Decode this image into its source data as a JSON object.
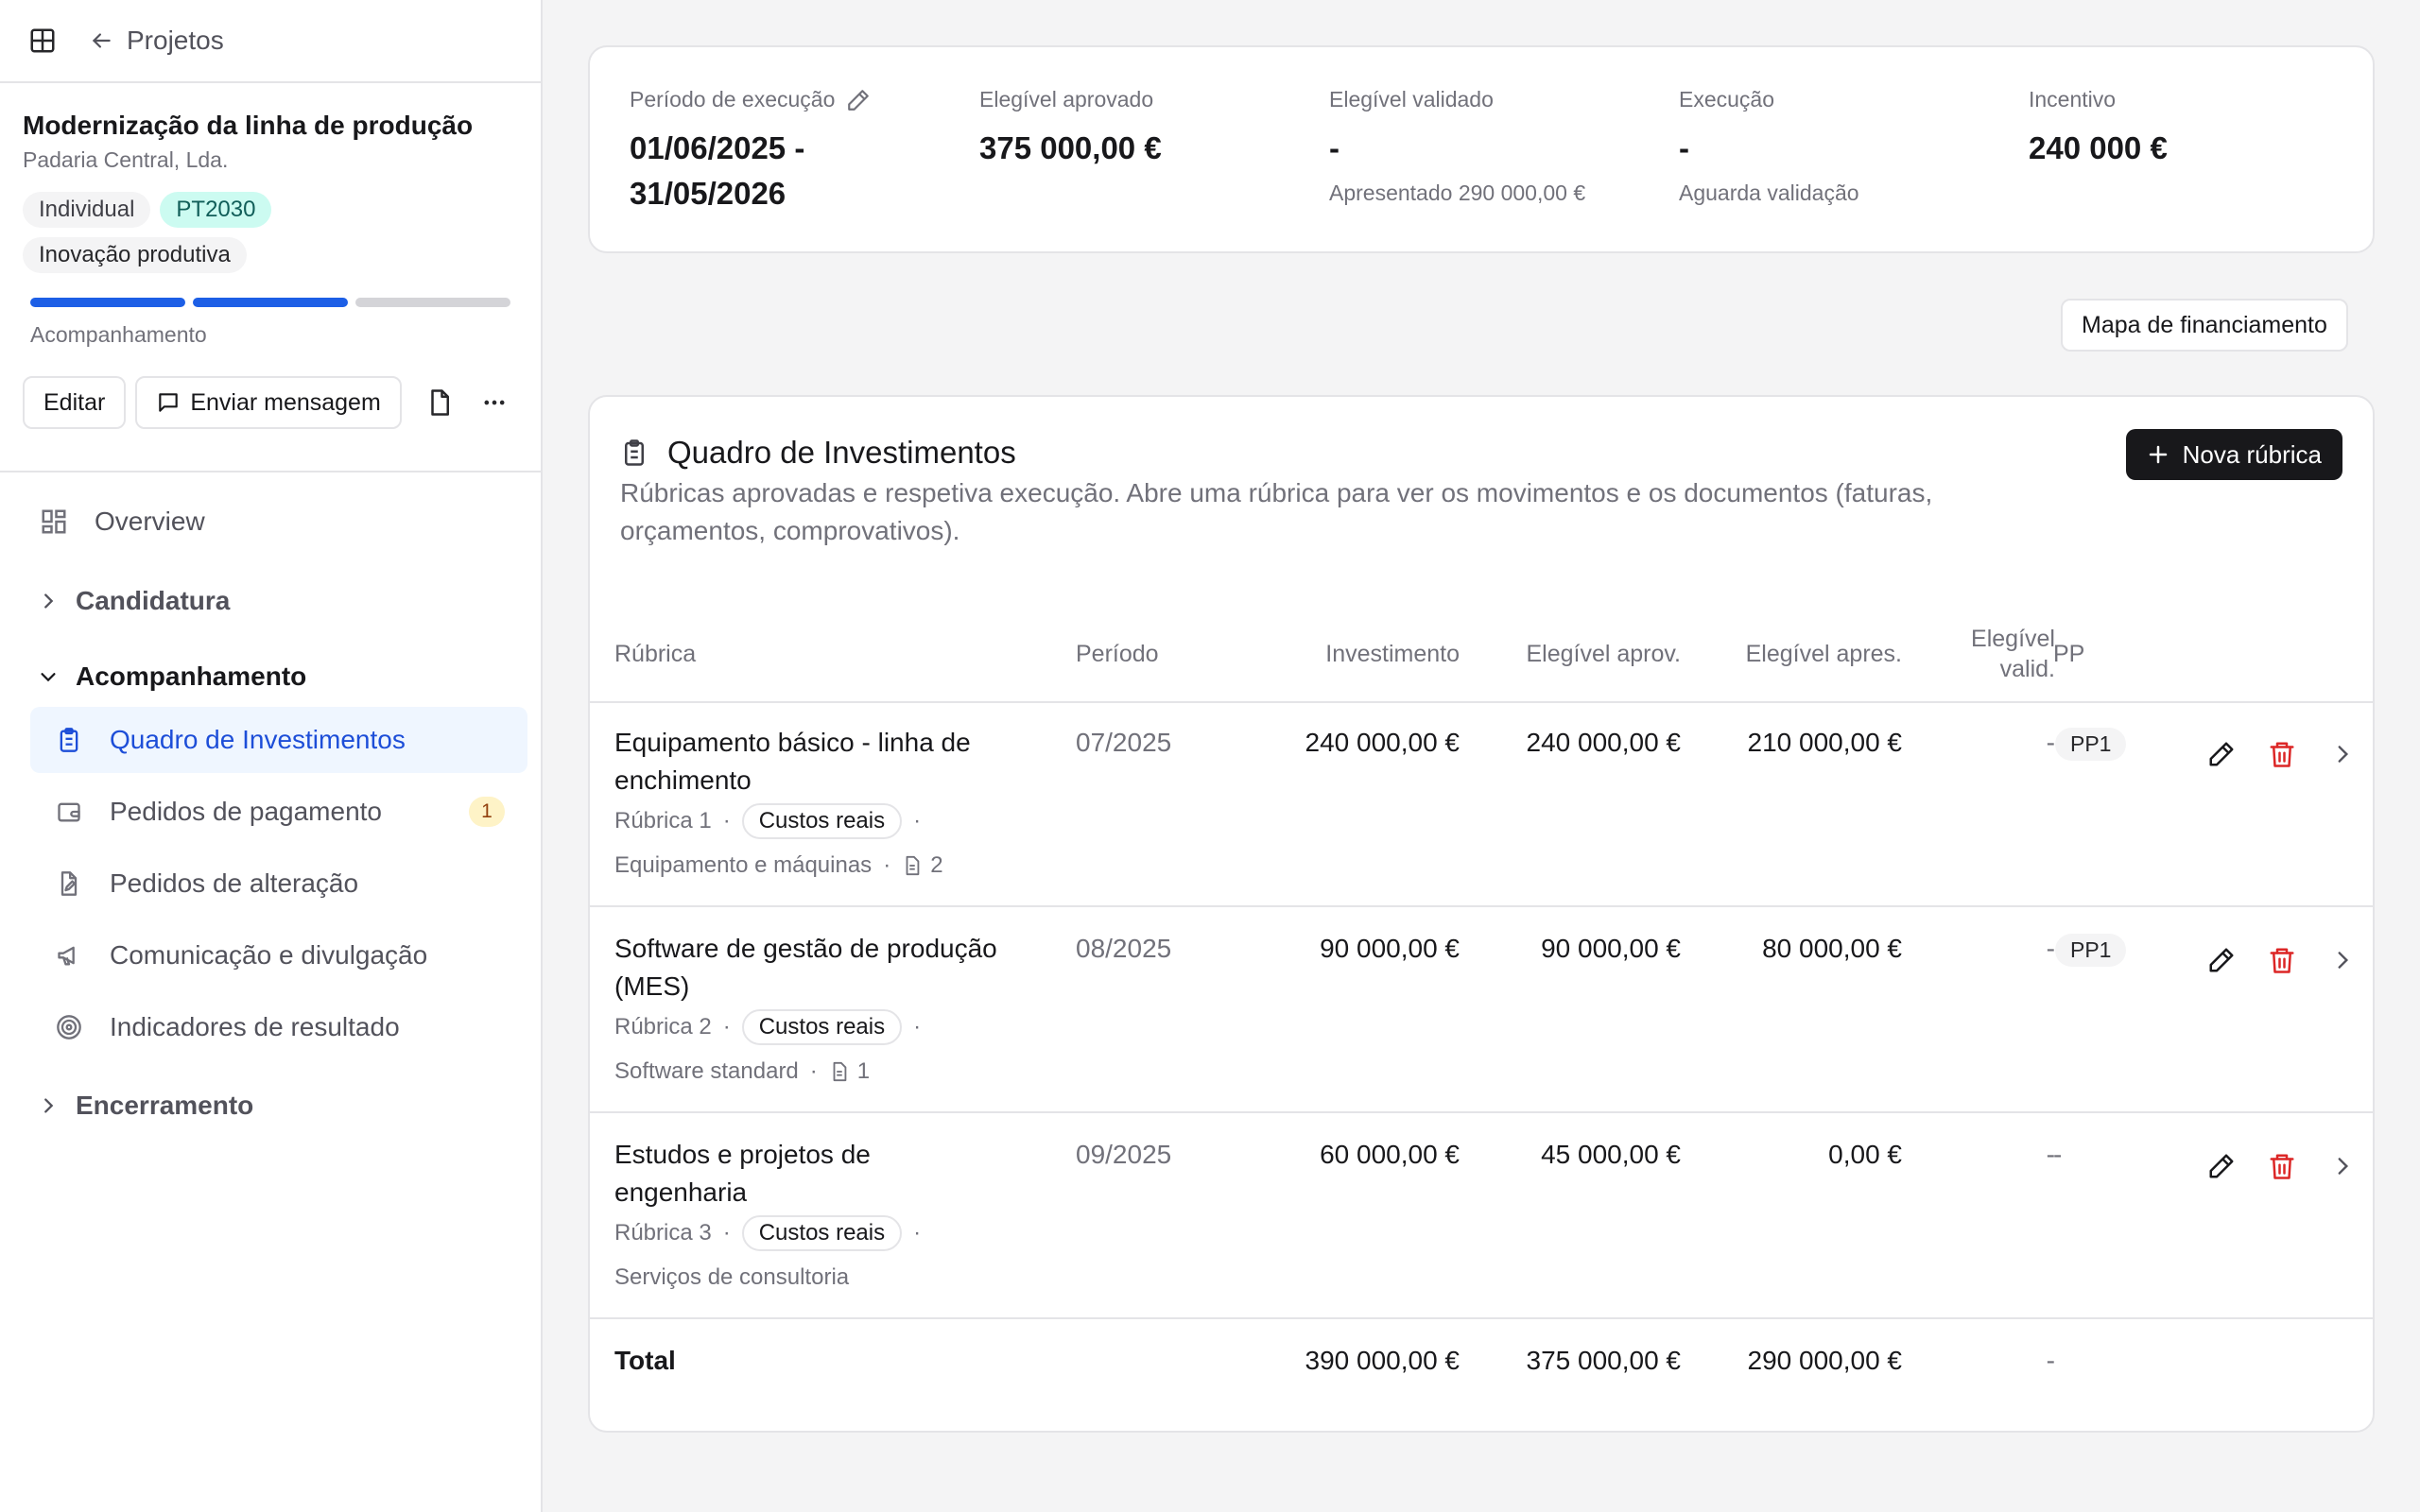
{
  "topbar": {
    "back_label": "Projetos"
  },
  "project": {
    "title": "Modernização da linha de produção",
    "company": "Padaria Central, Lda.",
    "badges": [
      "Individual",
      "PT2030",
      "Inovação produtiva"
    ],
    "progress_steps": 3,
    "progress_done": 2,
    "stage_label": "Acompanhamento"
  },
  "project_actions": {
    "edit_label": "Editar",
    "message_label": "Enviar mensagem"
  },
  "nav": {
    "overview": "Overview",
    "sections": [
      {
        "label": "Candidatura",
        "expanded": false
      },
      {
        "label": "Acompanhamento",
        "expanded": true
      },
      {
        "label": "Encerramento",
        "expanded": false
      }
    ],
    "items": [
      {
        "label": "Quadro de Investimentos",
        "active": true,
        "icon": "clipboard-list-icon"
      },
      {
        "label": "Pedidos de pagamento",
        "count": "1",
        "icon": "wallet-icon"
      },
      {
        "label": "Pedidos de alteração",
        "icon": "file-edit-icon"
      },
      {
        "label": "Comunicação e divulgação",
        "icon": "megaphone-icon"
      },
      {
        "label": "Indicadores de resultado",
        "icon": "target-icon"
      }
    ]
  },
  "kpis": [
    {
      "label": "Período de execução",
      "value": "01/06/2025 -",
      "value2": "31/05/2026",
      "editable": true
    },
    {
      "label": "Elegível aprovado",
      "value": "375 000,00 €"
    },
    {
      "label": "Elegível validado",
      "value": "-",
      "note": "Apresentado 290 000,00 €"
    },
    {
      "label": "Execução",
      "value": "-",
      "note": "Aguarda validação"
    },
    {
      "label": "Incentivo",
      "value": "240 000 €"
    }
  ],
  "funding_map_label": "Mapa de financiamento",
  "investments": {
    "title": "Quadro de Investimentos",
    "description": "Rúbricas aprovadas e respetiva execução. Abre uma rúbrica para ver os movimentos e os documentos (faturas, orçamentos, comprovativos).",
    "new_label": "Nova rúbrica",
    "columns": {
      "rubrica": "Rúbrica",
      "periodo": "Período",
      "investimento": "Investimento",
      "eleg_aprov": "Elegível aprov.",
      "eleg_apres": "Elegível apres.",
      "eleg_valid_1": "Elegível",
      "eleg_valid_2": "valid.",
      "pp": "PP"
    },
    "rows": [
      {
        "name_1": "Equipamento básico - linha de",
        "name_2": "enchimento",
        "rubrica": "Rúbrica 1",
        "cost_type": "Custos reais",
        "category": "Equipamento e máquinas",
        "docs": "2",
        "periodo": "07/2025",
        "investimento": "240 000,00 €",
        "eleg_aprov": "240 000,00 €",
        "eleg_apres": "210 000,00 €",
        "eleg_valid": "-",
        "pp": "PP1"
      },
      {
        "name_1": "Software de gestão de produção",
        "name_2": "(MES)",
        "rubrica": "Rúbrica 2",
        "cost_type": "Custos reais",
        "category": "Software standard",
        "docs": "1",
        "periodo": "08/2025",
        "investimento": "90 000,00 €",
        "eleg_aprov": "90 000,00 €",
        "eleg_apres": "80 000,00 €",
        "eleg_valid": "-",
        "pp": "PP1"
      },
      {
        "name_1": "Estudos e projetos de",
        "name_2": "engenharia",
        "rubrica": "Rúbrica 3",
        "cost_type": "Custos reais",
        "category": "Serviços de consultoria",
        "periodo": "09/2025",
        "investimento": "60 000,00 €",
        "eleg_aprov": "45 000,00 €",
        "eleg_apres": "0,00 €",
        "eleg_valid": "-",
        "pp": "-"
      }
    ],
    "total": {
      "label": "Total",
      "investimento": "390 000,00 €",
      "eleg_aprov": "375 000,00 €",
      "eleg_apres": "290 000,00 €",
      "eleg_valid": "-"
    }
  },
  "colors": {
    "accent": "#1d5fe6",
    "danger": "#dc2626",
    "active_bg": "#eff6ff",
    "dark_button": "#18181b"
  }
}
